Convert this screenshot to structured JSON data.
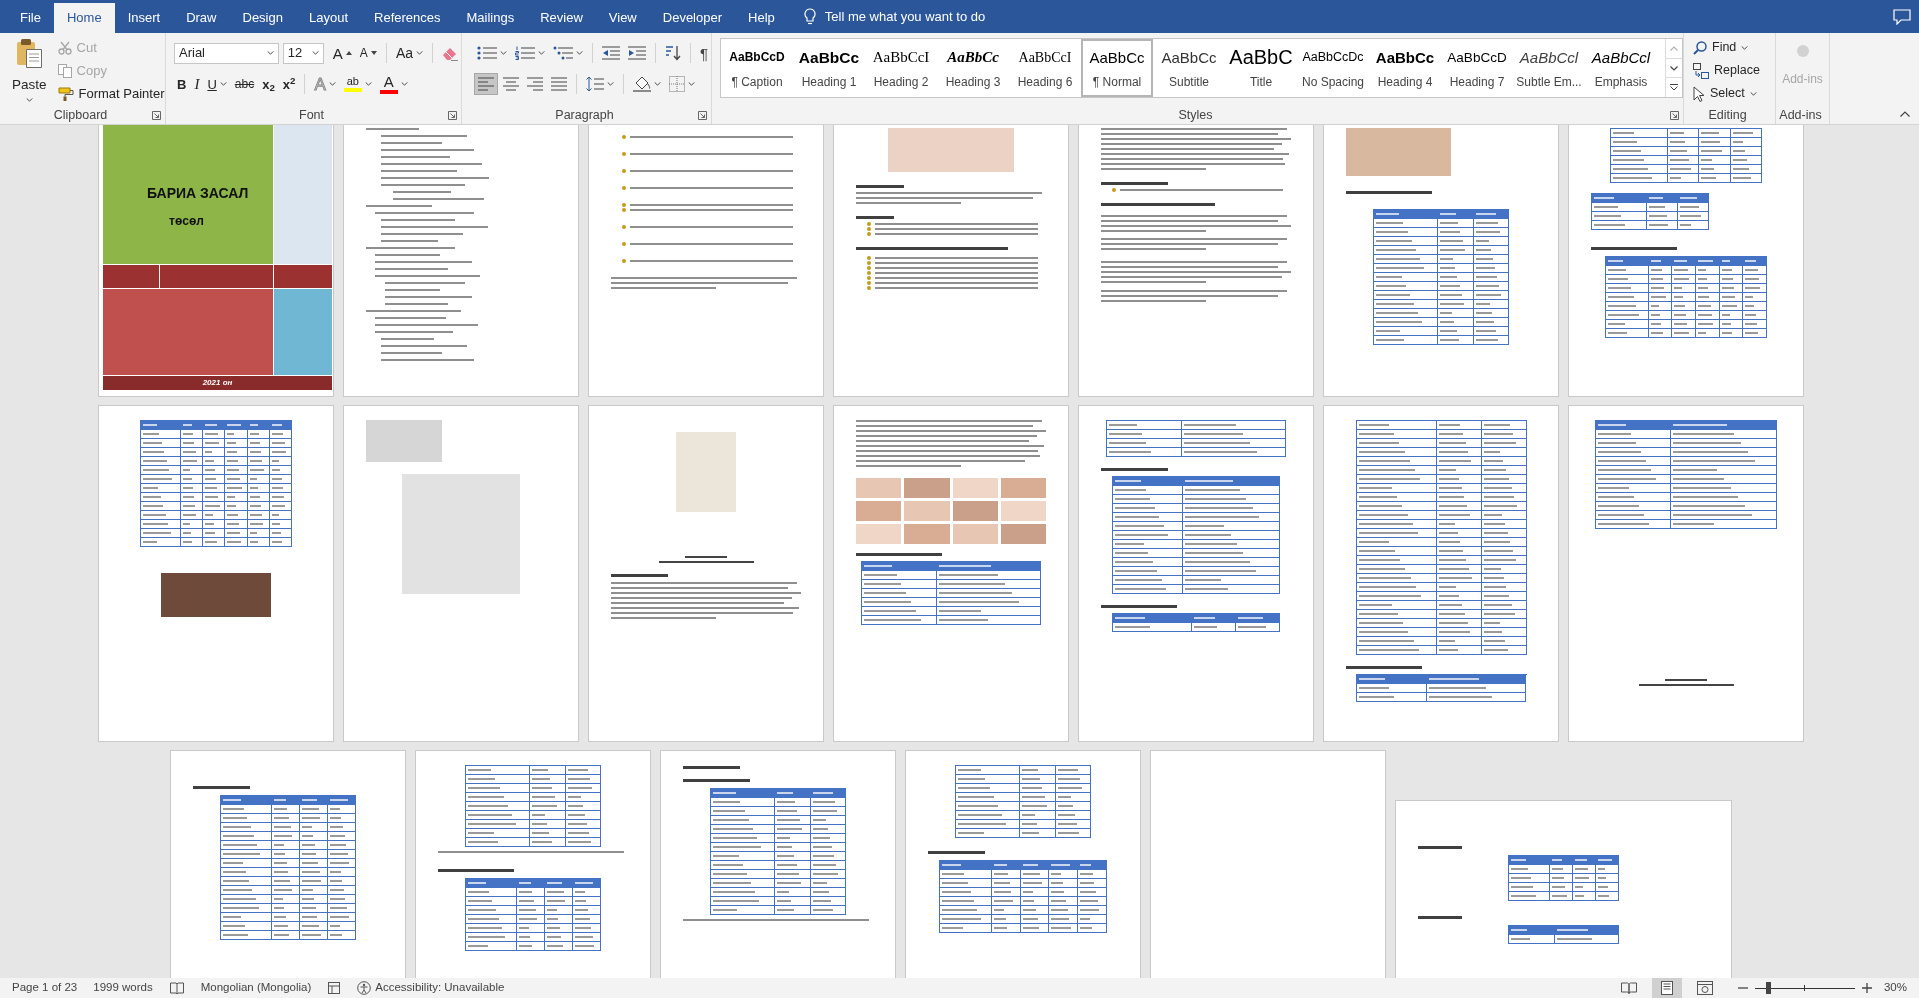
{
  "tabs": [
    {
      "label": "File",
      "selected": false
    },
    {
      "label": "Home",
      "selected": true
    },
    {
      "label": "Insert",
      "selected": false
    },
    {
      "label": "Draw",
      "selected": false
    },
    {
      "label": "Design",
      "selected": false
    },
    {
      "label": "Layout",
      "selected": false
    },
    {
      "label": "References",
      "selected": false
    },
    {
      "label": "Mailings",
      "selected": false
    },
    {
      "label": "Review",
      "selected": false
    },
    {
      "label": "View",
      "selected": false
    },
    {
      "label": "Developer",
      "selected": false
    },
    {
      "label": "Help",
      "selected": false
    }
  ],
  "tell_me": {
    "placeholder": "Tell me what you want to do"
  },
  "clipboard": {
    "label": "Clipboard",
    "launcher": true,
    "paste": "Paste",
    "tools": [
      {
        "kind": "cut",
        "label": "Cut",
        "disabled": true
      },
      {
        "kind": "copy",
        "label": "Copy",
        "disabled": true
      },
      {
        "kind": "painter",
        "label": "Format Painter",
        "disabled": false
      }
    ]
  },
  "font": {
    "label": "Font",
    "launcher": true,
    "font_name": "Arial",
    "font_size": "12",
    "row1": [
      {
        "kind": "grow",
        "label": "A"
      },
      {
        "kind": "shrink",
        "label": "A"
      },
      {
        "kind": "case",
        "label": "Aa"
      },
      {
        "kind": "clear"
      }
    ],
    "row2": [
      {
        "kind": "bold",
        "label": "B"
      },
      {
        "kind": "italic",
        "label": "I"
      },
      {
        "kind": "underline",
        "label": "U"
      },
      {
        "kind": "strike",
        "label": "abc"
      },
      {
        "kind": "subscript",
        "label": "x$_{2}$"
      },
      {
        "kind": "superscript",
        "label": "x$^{2}$"
      },
      {
        "kind": "effects",
        "label": "A"
      },
      {
        "kind": "highlight",
        "label": "ab",
        "color": "#ffff00"
      },
      {
        "kind": "color",
        "label": "A",
        "color": "#ff0000"
      }
    ]
  },
  "paragraph": {
    "label": "Paragraph",
    "launcher": true,
    "row1": [
      {
        "kind": "bullets"
      },
      {
        "kind": "numbering"
      },
      {
        "kind": "multilevel"
      },
      {
        "kind": "outdent"
      },
      {
        "kind": "indent"
      },
      {
        "kind": "sort"
      },
      {
        "kind": "marks",
        "label": "¶"
      }
    ],
    "alignment": [
      {
        "kind": "left",
        "selected": true
      },
      {
        "kind": "center",
        "selected": false
      },
      {
        "kind": "right",
        "selected": false
      },
      {
        "kind": "justify",
        "selected": false
      }
    ],
    "row2": [
      {
        "kind": "spacing"
      },
      {
        "kind": "shading"
      },
      {
        "kind": "borders"
      }
    ]
  },
  "styles": {
    "label": "Styles",
    "launcher": true,
    "items": [
      {
        "preview": "AaBbCcD",
        "name": "¶ Caption",
        "kind": "caption",
        "selected": false
      },
      {
        "preview": "AaBbCc",
        "name": "Heading 1",
        "kind": "heading-1",
        "selected": false
      },
      {
        "preview": "AaBbCcI",
        "name": "Heading 2",
        "kind": "heading-2",
        "selected": false
      },
      {
        "preview": "AaBbCc",
        "name": "Heading 3",
        "kind": "heading-3",
        "selected": false
      },
      {
        "preview": "AaBbCcI",
        "name": "Heading 6",
        "kind": "heading-6",
        "selected": false
      },
      {
        "preview": "AaBbCc",
        "name": "¶ Normal",
        "kind": "normal",
        "selected": true
      },
      {
        "preview": "AaBbCc",
        "name": "Subtitle",
        "kind": "subtitle",
        "selected": false
      },
      {
        "preview": "AaBbC",
        "name": "Title",
        "kind": "title",
        "selected": false
      },
      {
        "preview": "AaBbCcDc",
        "name": "No Spacing",
        "kind": "no-spacing",
        "selected": false
      },
      {
        "preview": "AaBbCc",
        "name": "Heading 4",
        "kind": "heading-4",
        "selected": false
      },
      {
        "preview": "AaBbCcD",
        "name": "Heading 7",
        "kind": "heading-7",
        "selected": false
      },
      {
        "preview": "AaBbCcl",
        "name": "Subtle Em...",
        "kind": "subtle-emphasis",
        "selected": false
      },
      {
        "preview": "AaBbCcl",
        "name": "Emphasis",
        "kind": "emphasis",
        "selected": false
      }
    ]
  },
  "editing": {
    "label": "Editing",
    "tools": [
      {
        "kind": "find",
        "label": "Find"
      },
      {
        "kind": "replace",
        "label": "Replace"
      },
      {
        "kind": "select",
        "label": "Select"
      }
    ]
  },
  "add_ins": {
    "label": "Add-ins",
    "button": "Add-ins",
    "disabled": true
  },
  "document": {
    "rows": [
      {
        "pages": [
          {
            "kind": "cover",
            "title": "БАРИА ЗАСАЛ",
            "subtitle": "төсөл",
            "footer": "2021 он"
          },
          {
            "kind": "toc"
          },
          {
            "kind": "bullets"
          },
          {
            "kind": "photo-text"
          },
          {
            "kind": "text"
          },
          {
            "kind": "photo-table"
          },
          {
            "kind": "tables"
          }
        ]
      },
      {
        "pages": [
          {
            "kind": "table-photo"
          },
          {
            "kind": "photos"
          },
          {
            "kind": "photo-heading"
          },
          {
            "kind": "gallery"
          },
          {
            "kind": "table-list"
          },
          {
            "kind": "long-table"
          },
          {
            "kind": "table-end"
          }
        ]
      },
      {
        "pages": [
          {
            "kind": "heading-table"
          },
          {
            "kind": "table-text"
          },
          {
            "kind": "two-headings"
          },
          {
            "kind": "tables-b"
          },
          {
            "kind": "blank"
          },
          {
            "kind": "landscape"
          }
        ]
      }
    ]
  },
  "status_bar": {
    "page": "Page 1 of 23",
    "words": "1999 words",
    "language": "Mongolian (Mongolia)",
    "accessibility": "Accessibility: Unavailable",
    "views": [
      {
        "kind": "read",
        "selected": false
      },
      {
        "kind": "print",
        "selected": true
      },
      {
        "kind": "web",
        "selected": false
      }
    ],
    "zoom": {
      "level": 0.13,
      "reading": "30%"
    }
  }
}
